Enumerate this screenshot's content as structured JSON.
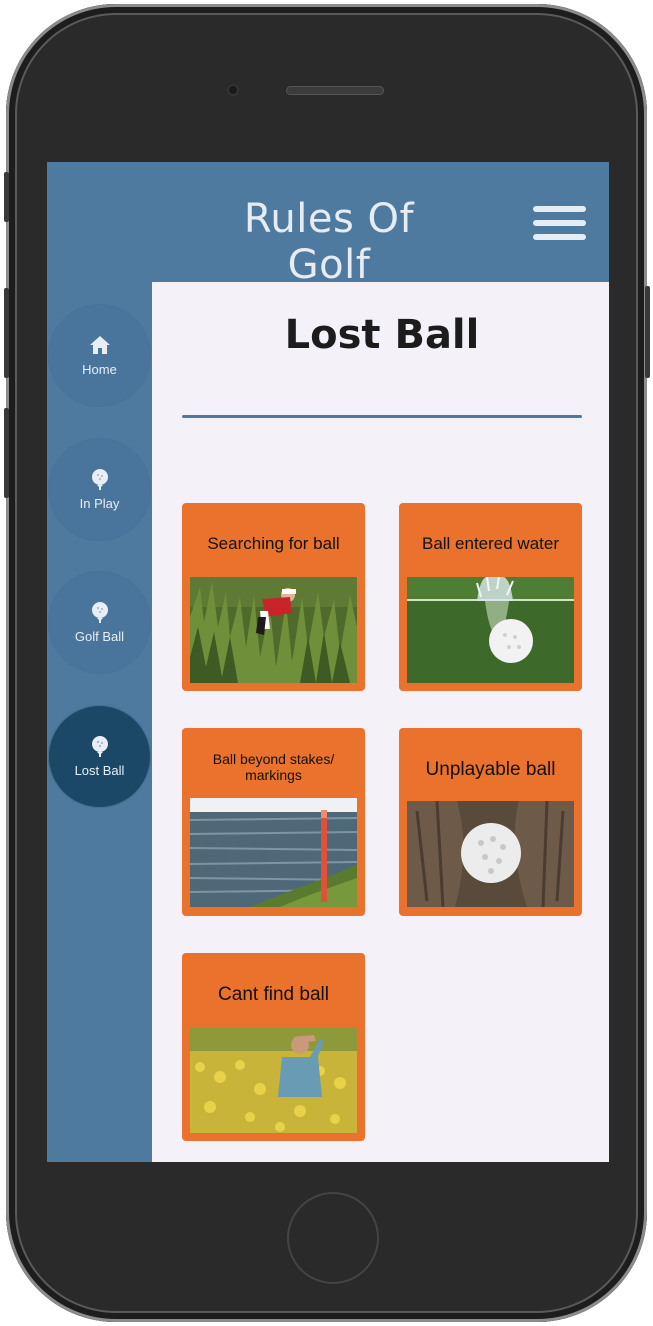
{
  "header": {
    "title": "Rules Of Golf",
    "menu_icon": "hamburger-icon"
  },
  "sidebar": {
    "items": [
      {
        "label": "Home",
        "icon": "home-icon",
        "active": false
      },
      {
        "label": "In Play",
        "icon": "golf-ball-tee-icon",
        "active": false
      },
      {
        "label": "Golf Ball",
        "icon": "golf-ball-tee-icon",
        "active": false
      },
      {
        "label": "Lost Ball",
        "icon": "golf-ball-tee-icon",
        "active": true
      }
    ]
  },
  "page": {
    "title": "Lost Ball",
    "cards": [
      {
        "title": "Searching for ball",
        "image": "golfer searching in tall grass"
      },
      {
        "title": "Ball entered water",
        "image": "golf ball splashing into water"
      },
      {
        "title": "Ball beyond stakes/ markings",
        "image": "water hazard with red stake"
      },
      {
        "title": "Unplayable ball",
        "image": "golf ball wedged between tree roots"
      },
      {
        "title": "Cant find ball",
        "image": "man shading eyes in yellow flower field"
      }
    ]
  },
  "colors": {
    "header_bg": "#4f7aa0",
    "sidebar_active": "#1a4866",
    "card_bg": "#ea722d",
    "content_bg": "#f4f2f8"
  }
}
